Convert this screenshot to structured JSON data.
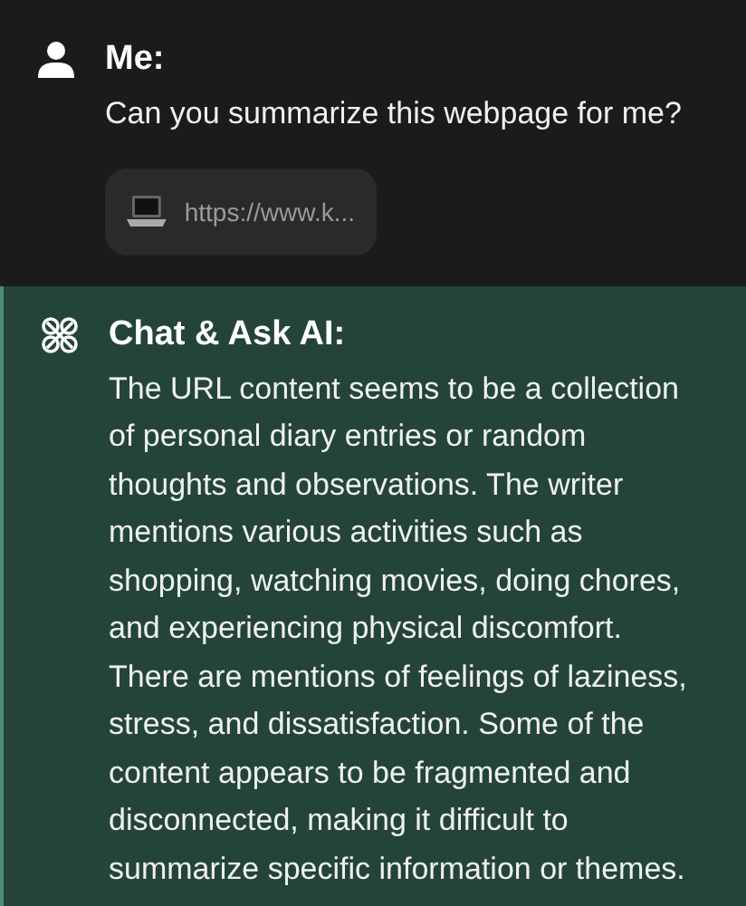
{
  "messages": [
    {
      "kind": "user",
      "sender": "Me:",
      "text": "Can you summarize this webpage for me?",
      "link": "https://www.k..."
    },
    {
      "kind": "assistant",
      "sender": "Chat & Ask AI:",
      "text": "The URL content seems to be a collection of personal diary entries or random thoughts and observations. The writer mentions various activities such as shopping, watching movies, doing chores, and experiencing physical discomfort. There are mentions of feelings of laziness, stress, and dissatisfaction. Some of the content appears to be fragmented and disconnected, making it difficult to summarize specific information or themes."
    }
  ]
}
